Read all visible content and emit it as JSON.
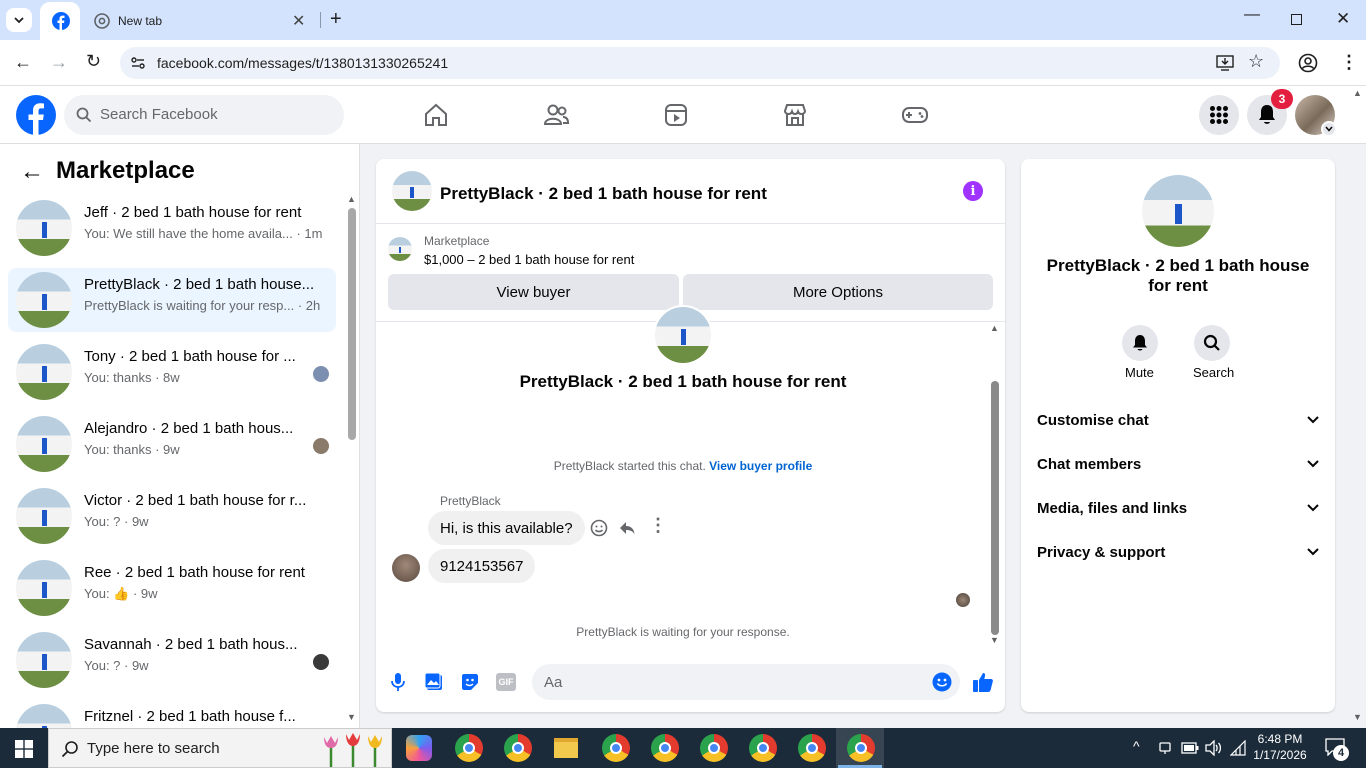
{
  "browser": {
    "tab_title": "New tab",
    "url": "facebook.com/messages/t/1380131330265241"
  },
  "fb": {
    "search_placeholder": "Search Facebook",
    "notification_count": "3"
  },
  "sidebar": {
    "title": "Marketplace",
    "conversations": [
      {
        "title": "Jeff · 2 bed 1 bath house for rent",
        "subtitle": "You: We still have the home availa... · 1m"
      },
      {
        "title": "PrettyBlack · 2 bed 1 bath house...",
        "subtitle": "PrettyBlack is waiting for your resp... · 2h"
      },
      {
        "title": "Tony · 2 bed 1 bath house for ...",
        "subtitle": "You: thanks · 8w"
      },
      {
        "title": "Alejandro · 2 bed 1 bath hous...",
        "subtitle": "You: thanks · 9w"
      },
      {
        "title": "Victor · 2 bed 1 bath house for r...",
        "subtitle": "You: ? · 9w"
      },
      {
        "title": "Ree · 2 bed 1 bath house for rent",
        "subtitle": "You: 👍 · 9w"
      },
      {
        "title": "Savannah · 2 bed 1 bath hous...",
        "subtitle": "You: ? · 9w"
      },
      {
        "title": "Fritznel · 2 bed 1 bath house f...",
        "subtitle": ""
      }
    ]
  },
  "chat": {
    "header_title": "PrettyBlack · 2 bed 1 bath house for rent",
    "listing_source": "Marketplace",
    "listing_price": "$1,000 – 2 bed 1 bath house for rent",
    "view_buyer": "View buyer",
    "more_options": "More Options",
    "center_title": "PrettyBlack · 2 bed 1 bath house for rent",
    "started_text": "PrettyBlack started this chat.",
    "view_buyer_profile": "View buyer profile",
    "sender_name": "PrettyBlack",
    "messages": [
      "Hi, is this available?",
      "9124153567"
    ],
    "waiting_text": "PrettyBlack is waiting for your response.",
    "composer_placeholder": "Aa"
  },
  "details": {
    "title": "PrettyBlack · 2 bed 1 bath house for rent",
    "mute": "Mute",
    "search": "Search",
    "sections": [
      "Customise chat",
      "Chat members",
      "Media, files and links",
      "Privacy & support"
    ]
  },
  "taskbar": {
    "search_placeholder": "Type here to search",
    "time": "6:48 PM",
    "date": "1/17/2026",
    "notif_count": "4"
  },
  "colors": {
    "fb_blue": "#0866ff",
    "accent_purple": "#a033ff"
  }
}
